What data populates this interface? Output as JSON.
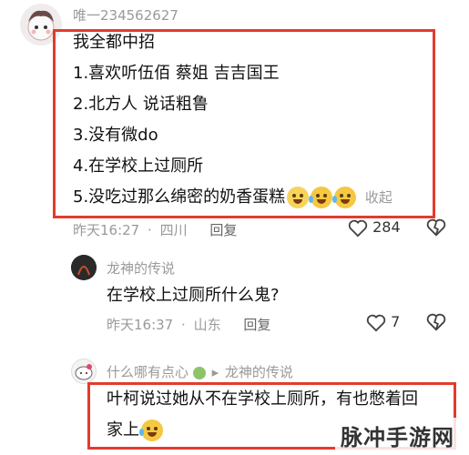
{
  "comment1": {
    "username": "唯一234562627",
    "lines": [
      "我全都中招",
      "1.喜欢听伍佰 蔡姐 吉吉国王",
      "2.北方人 说话粗鲁",
      "3.没有微do",
      "4.在学校上过厕所",
      "5.没吃过那么绵密的奶香蛋糕"
    ],
    "collapse": "收起",
    "time": "昨天16:27",
    "dot": "·",
    "location": "四川",
    "reply": "回复",
    "likes": "284"
  },
  "comment2": {
    "username": "龙神的传说",
    "text": "在学校上过厕所什么鬼?",
    "time": "昨天16:37",
    "dot": "·",
    "location": "山东",
    "reply": "回复",
    "likes": "7"
  },
  "comment3": {
    "username": "什么哪有点心",
    "arrow": "▸",
    "reply_to": "龙神的传说",
    "line1": "叶柯说过她从不在学校上厕所，有也憋着回",
    "line2": "家上"
  },
  "watermark": "脉冲手游网",
  "colors": {
    "highlight_border": "#e23b2e",
    "meta_gray": "#9a9a9a"
  }
}
